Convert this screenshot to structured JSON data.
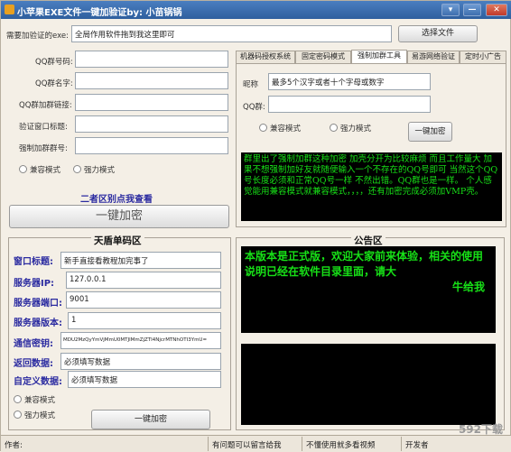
{
  "window": {
    "title": "小苹果EXE文件一键加验证by: 小苗锅锅",
    "controls": [
      "▾",
      "—",
      "✕"
    ]
  },
  "top": {
    "label": "需要加验证的exe:",
    "value": "全局作用软件拖到我这里即可",
    "browse_button": "选择文件"
  },
  "left_form": {
    "fields": [
      {
        "label": "QQ群号码:",
        "value": ""
      },
      {
        "label": "QQ群名字:",
        "value": ""
      },
      {
        "label": "QQ群加群链接:",
        "value": ""
      },
      {
        "label": "验证窗口标题:",
        "value": ""
      },
      {
        "label": "强制加群群号:",
        "value": ""
      }
    ],
    "radio_compat": "兼容模式",
    "radio_strong": "强力模式",
    "link": "二者区别点我查看",
    "encrypt_button": "一键加密"
  },
  "tabs": [
    "机器码授权系统",
    "固定密码模式",
    "强制加群工具",
    "易游网络验证",
    "定时小广告"
  ],
  "tab_panel": {
    "nickname_label": "昵称",
    "nickname_value": "最多5个汉字或者十个字母或数字",
    "qq_group_label": "QQ群:",
    "qq_group_value": "",
    "radio_compat": "兼容模式",
    "radio_strong": "强力模式",
    "encrypt_button": "一键加密",
    "console_text": "群里出了强制加群这种加密 加壳分开为比较麻烦 而且工作量大 加果不想强制加好友就随便输入一个不存在的QQ号即可 当然这个QQ号长度必须和正常QQ号一样 不然出错。QQ群也是一样。 个人感觉能用兼容模式就兼容模式，，，，还有加密完成必须加VMP壳。"
  },
  "tiandun": {
    "title": "天盾单码区",
    "fields": [
      {
        "label": "窗口标题:",
        "value": "新手直接看教程加完事了"
      },
      {
        "label": "服务器IP:",
        "value": "127.0.0.1"
      },
      {
        "label": "服务器端口:",
        "value": "9001"
      },
      {
        "label": "服务器版本:",
        "value": "1"
      },
      {
        "label": "通信密钥:",
        "value": "MDU2MzQyYmVjMmU0MTJlMmZjZTI4NjcrMTNhOTI3YmU="
      },
      {
        "label": "返回数据:",
        "value": "必须填写数据"
      },
      {
        "label": "自定义数据:",
        "value": "必须填写数据"
      }
    ],
    "radio_compat": "兼容模式",
    "radio_strong": "强力模式",
    "encrypt_button": "一键加密"
  },
  "notice": {
    "title": "公告区",
    "text": "本版本是正式版，欢迎大家前来体验，相关的使用说明已经在软件目录里面，请大",
    "text2": "牛给我"
  },
  "statusbar": {
    "items": [
      "作者:",
      "有问题可以留言给我",
      "不懂使用就多看视频",
      "开发者"
    ]
  },
  "watermark": "592下载"
}
